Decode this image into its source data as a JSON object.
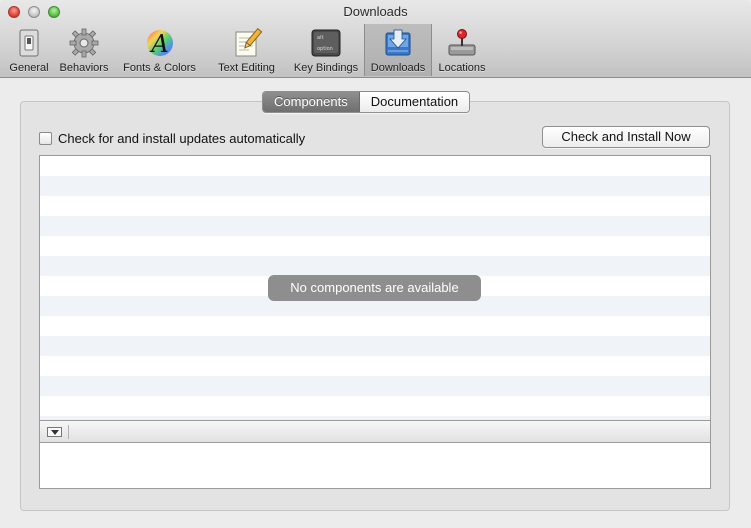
{
  "window": {
    "title": "Downloads"
  },
  "toolbar": {
    "items": [
      {
        "label": "General",
        "icon": "general-switch-icon"
      },
      {
        "label": "Behaviors",
        "icon": "gear-icon"
      },
      {
        "label": "Fonts & Colors",
        "icon": "font-color-icon"
      },
      {
        "label": "Text Editing",
        "icon": "pencil-paper-icon"
      },
      {
        "label": "Key Bindings",
        "icon": "keyboard-key-icon"
      },
      {
        "label": "Downloads",
        "icon": "download-tray-icon",
        "selected": true
      },
      {
        "label": "Locations",
        "icon": "joystick-drive-icon"
      }
    ]
  },
  "tabs": {
    "components": "Components",
    "documentation": "Documentation",
    "active": "Components"
  },
  "auto_update": {
    "label": "Check for and install updates automatically",
    "checked": false
  },
  "check_button": {
    "label": "Check and Install Now"
  },
  "components_list": {
    "empty_message": "No components are available"
  },
  "colors": {
    "selected_tab": "#7f7f7f",
    "badge": "#8e8e8e",
    "row_stripe": "#f0f3f7"
  }
}
